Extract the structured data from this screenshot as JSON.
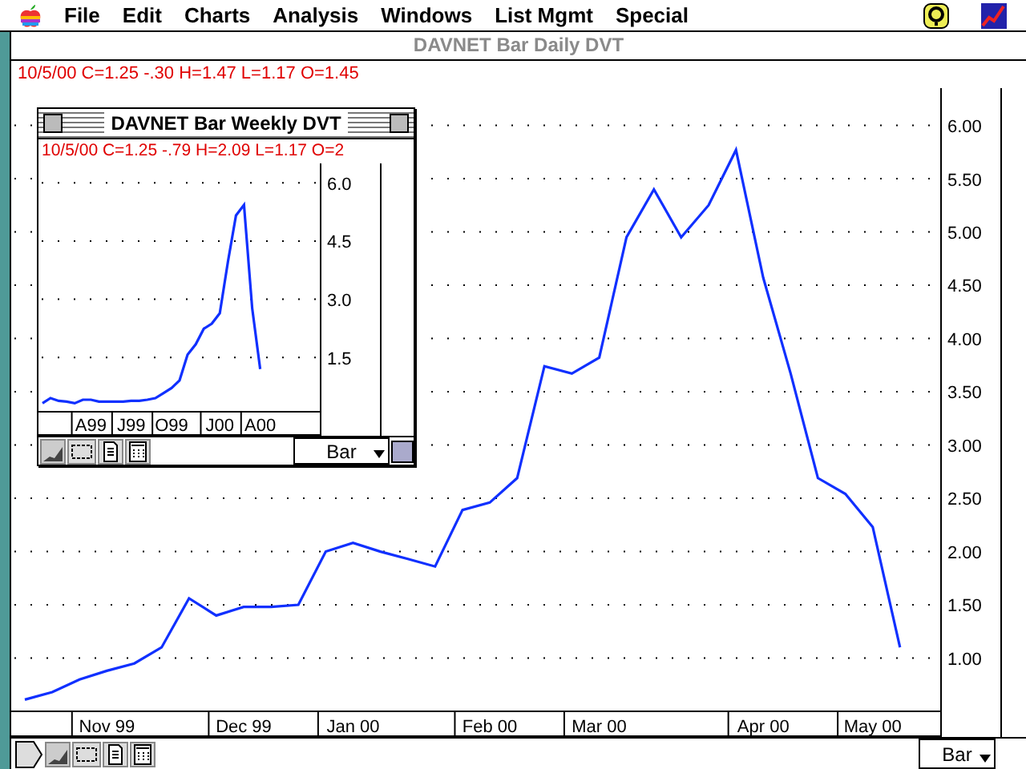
{
  "menu_bar": {
    "items": [
      "File",
      "Edit",
      "Charts",
      "Analysis",
      "Windows",
      "List Mgmt",
      "Special"
    ]
  },
  "main_window": {
    "title": "DAVNET Bar Daily DVT",
    "quote_line": "10/5/00 C=1.25 -.30 H=1.47 L=1.17 O=1.45",
    "chart_data": {
      "type": "line",
      "grid": true,
      "categories": [
        null,
        null,
        null,
        "Nov 99",
        null,
        null,
        null,
        null,
        "Dec 99",
        null,
        null,
        null,
        "Jan 00",
        null,
        null,
        null,
        null,
        "Feb 00",
        null,
        null,
        null,
        "Mar 00",
        null,
        null,
        null,
        null,
        null,
        "Apr 00",
        null,
        null,
        null,
        "May 00",
        null,
        null
      ],
      "series": [
        {
          "color": "#1030ff",
          "values": [
            0.61,
            0.68,
            0.8,
            0.88,
            0.95,
            1.1,
            1.56,
            1.4,
            1.48,
            1.48,
            1.5,
            2.0,
            2.08,
            2.0,
            1.93,
            1.86,
            2.39,
            2.46,
            2.69,
            3.74,
            3.67,
            3.82,
            4.95,
            5.4,
            4.95,
            5.25,
            5.77,
            4.57,
            3.67,
            2.69,
            2.54,
            2.23,
            1.1,
            null
          ]
        }
      ],
      "ylim": [
        0.5,
        6.35
      ],
      "yticks": [
        {
          "value": 6,
          "label": "6.00"
        },
        {
          "value": 5.5,
          "label": "5.50"
        },
        {
          "value": 5,
          "label": "5.00"
        },
        {
          "value": 4.5,
          "label": "4.50"
        },
        {
          "value": 4,
          "label": "4.00"
        },
        {
          "value": 3.5,
          "label": "3.50"
        },
        {
          "value": 3,
          "label": "3.00"
        },
        {
          "value": 2.5,
          "label": "2.50"
        },
        {
          "value": 2,
          "label": "2.00"
        },
        {
          "value": 1.5,
          "label": "1.50"
        },
        {
          "value": 1,
          "label": "1.00"
        }
      ]
    },
    "chart_type": "Bar"
  },
  "inset_window": {
    "title": "DAVNET Bar Weekly DVT",
    "quote_line": "10/5/00 C=1.25 -.79 H=2.09 L=1.17 O=2",
    "chart_data": {
      "type": "line",
      "grid": true,
      "categories": [
        null,
        null,
        null,
        null,
        null,
        null,
        "A99",
        null,
        null,
        null,
        null,
        "J99",
        null,
        null,
        null,
        null,
        "O99",
        null,
        null,
        null,
        null,
        null,
        "J00",
        null,
        null,
        null,
        null,
        "A00",
        null,
        null,
        null,
        null,
        null,
        null,
        null
      ],
      "series": [
        {
          "color": "#1030ff",
          "values": [
            0.32,
            0.45,
            0.38,
            0.36,
            0.32,
            0.41,
            0.41,
            0.36,
            0.36,
            0.36,
            0.36,
            0.38,
            0.38,
            0.41,
            0.45,
            0.58,
            0.71,
            0.91,
            1.57,
            1.84,
            2.24,
            2.37,
            2.64,
            3.97,
            5.16,
            5.43,
            2.77,
            1.2,
            null,
            null,
            null,
            null,
            null,
            null,
            null
          ]
        }
      ],
      "ylim": [
        0.1,
        6.5
      ],
      "yticks": [
        {
          "value": 6,
          "label": "6.0"
        },
        {
          "value": 4.5,
          "label": "4.5"
        },
        {
          "value": 3,
          "label": "3.0"
        },
        {
          "value": 1.5,
          "label": "1.5"
        }
      ]
    },
    "chart_type": "Bar"
  }
}
